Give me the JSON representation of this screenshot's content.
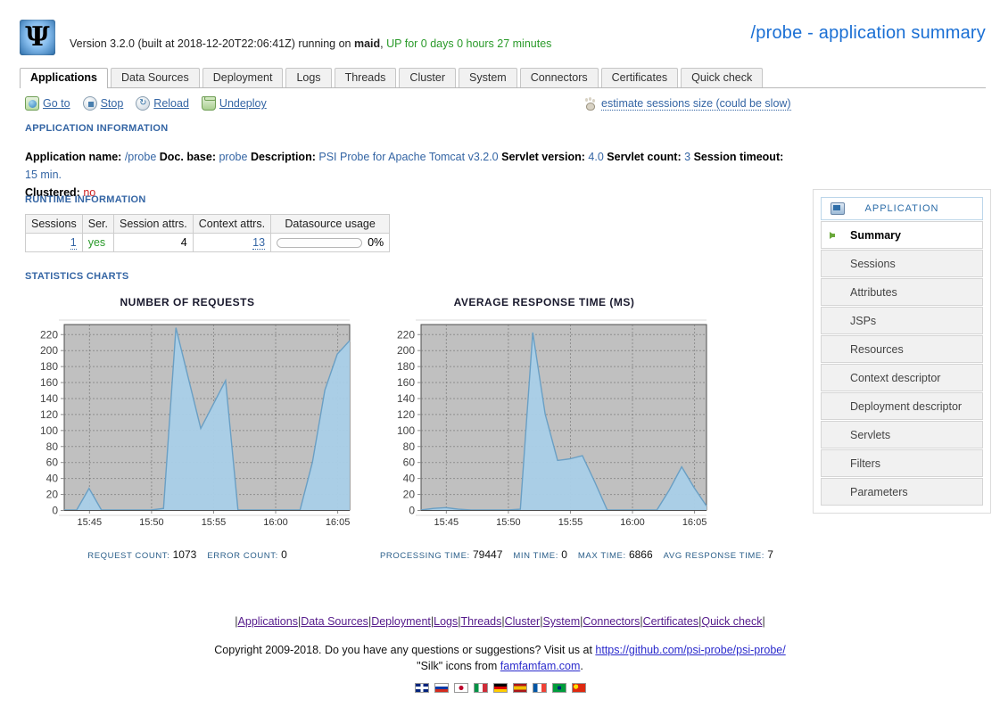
{
  "header": {
    "logo_glyph": "Ψ",
    "version_prefix": "Version 3.2.0 (built at 2018-12-20T22:06:41Z) running on ",
    "host": "maid",
    "version_comma": ",",
    "uptime": "UP for 0 days 0 hours 27 minutes",
    "page_title": "/probe - application summary"
  },
  "tabs": [
    {
      "label": "Applications",
      "active": true
    },
    {
      "label": "Data Sources",
      "active": false
    },
    {
      "label": "Deployment",
      "active": false
    },
    {
      "label": "Logs",
      "active": false
    },
    {
      "label": "Threads",
      "active": false
    },
    {
      "label": "Cluster",
      "active": false
    },
    {
      "label": "System",
      "active": false
    },
    {
      "label": "Connectors",
      "active": false
    },
    {
      "label": "Certificates",
      "active": false
    },
    {
      "label": "Quick check",
      "active": false
    }
  ],
  "actions": [
    {
      "label": "Go to",
      "icon": "world-go-icon"
    },
    {
      "label": "Stop",
      "icon": "stop-icon"
    },
    {
      "label": "Reload",
      "icon": "reload-icon"
    },
    {
      "label": "Undeploy",
      "icon": "bin-icon"
    }
  ],
  "estimate": {
    "label": "estimate sessions size (could be slow)",
    "icon": "footprints-icon"
  },
  "sections": {
    "application_information": "APPLICATION INFORMATION",
    "runtime_information": "RUNTIME INFORMATION",
    "statistics_charts": "STATISTICS CHARTS"
  },
  "app_info": {
    "name_label": "Application name:",
    "name_value": "/probe",
    "docbase_label": "Doc. base:",
    "docbase_value": "probe",
    "description_label": "Description:",
    "description_value": "PSI Probe for Apache Tomcat v3.2.0",
    "servlet_version_label": "Servlet version:",
    "servlet_version_value": "4.0",
    "servlet_count_label": "Servlet count:",
    "servlet_count_value": "3",
    "session_timeout_label": "Session timeout:",
    "session_timeout_value": "15 min.",
    "clustered_label": "Clustered:",
    "clustered_value": "no"
  },
  "runtime_table": {
    "headers": [
      "Sessions",
      "Ser.",
      "Session attrs.",
      "Context attrs.",
      "Datasource usage"
    ],
    "row": {
      "sessions": "1",
      "serializable": "yes",
      "session_attrs": "4",
      "context_attrs": "13",
      "datasource_usage_percent": "0%",
      "datasource_usage_value": 0
    }
  },
  "side_panel": {
    "header": "APPLICATION",
    "header_icon": "application-icon",
    "items": [
      {
        "label": "Summary",
        "active": true
      },
      {
        "label": "Sessions",
        "active": false
      },
      {
        "label": "Attributes",
        "active": false
      },
      {
        "label": "JSPs",
        "active": false
      },
      {
        "label": "Resources",
        "active": false
      },
      {
        "label": "Context descriptor",
        "active": false
      },
      {
        "label": "Deployment descriptor",
        "active": false
      },
      {
        "label": "Servlets",
        "active": false
      },
      {
        "label": "Filters",
        "active": false
      },
      {
        "label": "Parameters",
        "active": false
      }
    ]
  },
  "chart_data": [
    {
      "type": "area",
      "title": "NUMBER OF REQUESTS",
      "xlabel": "",
      "ylabel": "",
      "ylim": [
        0,
        232
      ],
      "yticks": [
        0,
        20,
        40,
        60,
        80,
        100,
        120,
        140,
        160,
        180,
        200,
        220
      ],
      "xticks": [
        "15:45",
        "15:50",
        "15:55",
        "16:00",
        "16:05"
      ],
      "xlim": [
        "15:43",
        "16:07"
      ],
      "grid": true,
      "plot_bg": "#c0c0c0",
      "series_color": "#a9cfe8",
      "line_color": "#6a9fc4",
      "x": [
        "15:43",
        "15:44",
        "15:45",
        "15:46",
        "15:47",
        "15:48",
        "15:49",
        "15:50",
        "15:51",
        "15:52",
        "15:53",
        "15:54",
        "15:55",
        "15:56",
        "15:57",
        "15:58",
        "15:59",
        "16:00",
        "16:01",
        "16:02",
        "16:03",
        "16:04",
        "16:05",
        "16:06"
      ],
      "values": [
        0,
        0,
        27,
        0,
        0,
        0,
        0,
        0,
        2,
        228,
        165,
        102,
        132,
        162,
        0,
        0,
        0,
        0,
        0,
        0,
        60,
        150,
        195,
        212
      ],
      "stats": [
        {
          "label": "REQUEST COUNT:",
          "value": "1073"
        },
        {
          "label": "ERROR COUNT:",
          "value": "0"
        }
      ]
    },
    {
      "type": "area",
      "title": "AVERAGE RESPONSE TIME (MS)",
      "xlabel": "",
      "ylabel": "",
      "ylim": [
        0,
        232
      ],
      "yticks": [
        0,
        20,
        40,
        60,
        80,
        100,
        120,
        140,
        160,
        180,
        200,
        220
      ],
      "xticks": [
        "15:45",
        "15:50",
        "15:55",
        "16:00",
        "16:05"
      ],
      "xlim": [
        "15:43",
        "16:07"
      ],
      "grid": true,
      "plot_bg": "#c0c0c0",
      "series_color": "#a9cfe8",
      "line_color": "#6a9fc4",
      "x": [
        "15:43",
        "15:44",
        "15:45",
        "15:46",
        "15:47",
        "15:48",
        "15:49",
        "15:50",
        "15:51",
        "15:52",
        "15:53",
        "15:54",
        "15:55",
        "15:56",
        "15:57",
        "15:58",
        "15:59",
        "16:00",
        "16:01",
        "16:02",
        "16:03",
        "16:04",
        "16:05",
        "16:06"
      ],
      "values": [
        0,
        2,
        3,
        1,
        0,
        0,
        0,
        0,
        1,
        222,
        120,
        62,
        64,
        68,
        35,
        0,
        0,
        0,
        0,
        0,
        25,
        54,
        28,
        5
      ],
      "stats": [
        {
          "label": "PROCESSING TIME:",
          "value": "79447"
        },
        {
          "label": "MIN TIME:",
          "value": "0"
        },
        {
          "label": "MAX TIME:",
          "value": "6866"
        },
        {
          "label": "AVG RESPONSE TIME:",
          "value": "7"
        }
      ]
    }
  ],
  "footer": {
    "links": [
      "Applications",
      "Data Sources",
      "Deployment",
      "Logs",
      "Threads",
      "Cluster",
      "System",
      "Connectors",
      "Certificates",
      "Quick check"
    ],
    "copyright_prefix": "Copyright 2009-2018. Do you have any questions or suggestions? Visit us at ",
    "copyright_url": "https://github.com/psi-probe/psi-probe/",
    "silk_prefix": "\"Silk\" icons from ",
    "silk_link": "famfamfam.com",
    "silk_suffix": ".",
    "flags": [
      "uk",
      "ru",
      "jp",
      "it",
      "de",
      "es",
      "fr",
      "br",
      "cn"
    ]
  }
}
